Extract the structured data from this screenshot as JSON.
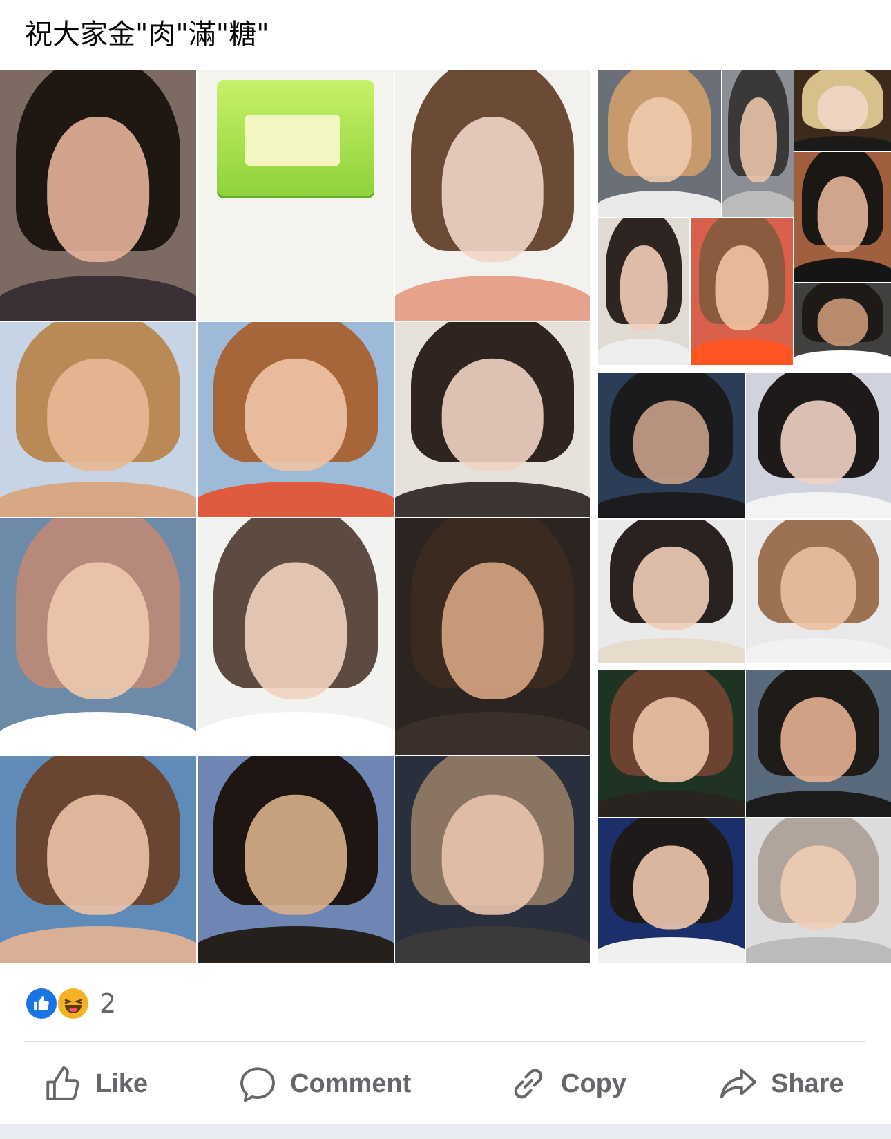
{
  "post": {
    "text": "祝大家金\"肉\"滿\"糖\""
  },
  "media": {
    "tiles": [
      {
        "kind": "portrait",
        "hair": "#1e1712",
        "skin": "#e5b39a",
        "bg": "#7d6b63",
        "top": "#3a3035"
      },
      {
        "kind": "product",
        "bg": "#f4f4ef"
      },
      {
        "kind": "portrait",
        "hair": "#6b4a36",
        "skin": "#f1d5c6",
        "bg": "#f3f1ee",
        "top": "#e6a28a"
      },
      {
        "kind": "portrait",
        "hair": "#b98a55",
        "skin": "#e8b896",
        "bg": "#c6d4e5",
        "top": "#d8a783"
      },
      {
        "kind": "portrait",
        "hair": "#a7653a",
        "skin": "#f0c4a7",
        "bg": "#9dbbd8",
        "top": "#e05a3d"
      },
      {
        "kind": "portrait",
        "hair": "#2f241f",
        "skin": "#f1d3c2",
        "bg": "#e7e1dc",
        "top": "#3c3533"
      },
      {
        "kind": "portrait",
        "hair": "#b7897a",
        "skin": "#f0c8ae",
        "bg": "#6d8aa8",
        "top": "#ffffff"
      },
      {
        "kind": "portrait",
        "hair": "#5d4a40",
        "skin": "#f1d2c0",
        "bg": "#f2f2f0",
        "top": "#ffffff"
      },
      {
        "kind": "portrait",
        "hair": "#3a2a20",
        "skin": "#d7a583",
        "bg": "#2b2420",
        "top": "#3a2f2a"
      },
      {
        "kind": "portrait",
        "hair": "#6a4531",
        "skin": "#ecc2a7",
        "bg": "#5f8bb8",
        "top": "#d9b095"
      },
      {
        "kind": "portrait",
        "hair": "#1f1512",
        "skin": "#d8b08a",
        "bg": "#6f86b5",
        "top": "#26201d"
      },
      {
        "kind": "portrait",
        "hair": "#8a7563",
        "skin": "#e9c4ad",
        "bg": "#2a2f3e",
        "top": "#3a3a3a"
      },
      {
        "kind": "portrait",
        "hair": "#c79a6e",
        "skin": "#f0c9ac",
        "bg": "#6b6f77",
        "top": "#e9e9ea"
      },
      {
        "kind": "portrait",
        "hair": "#3a3838",
        "skin": "#eac3a8",
        "bg": "#8b8e94",
        "top": "#bdbcbd"
      },
      {
        "kind": "portrait",
        "hair": "#d7c08b",
        "skin": "#f0d7c6",
        "bg": "#3d2a1c",
        "top": "#1b1a18"
      },
      {
        "kind": "portrait",
        "hair": "#1a1715",
        "skin": "#e6b49a",
        "bg": "#a0603f",
        "top": "#151515"
      },
      {
        "kind": "portrait",
        "hair": "#2e2523",
        "skin": "#f3ccb8",
        "bg": "#e0dbd2",
        "top": "#eeeeee"
      },
      {
        "kind": "portrait",
        "hair": "#8b5b3f",
        "skin": "#efc4a2",
        "bg": "#d9604a",
        "top": "#ff5522"
      },
      {
        "kind": "portrait",
        "hair": "#1d1a18",
        "skin": "#c99876",
        "bg": "#40403f",
        "top": "#ffffff"
      },
      {
        "kind": "portrait",
        "hair": "#1b1b1e",
        "skin": "#c9a088",
        "bg": "#2c3d57",
        "top": "#1b1c1f"
      },
      {
        "kind": "portrait",
        "hair": "#1f1a1a",
        "skin": "#f0d2c3",
        "bg": "#d0d2de",
        "top": "#f3f3f3"
      },
      {
        "kind": "portrait",
        "hair": "#2a2220",
        "skin": "#f0cdb7",
        "bg": "#eaeaea",
        "top": "#e7dccb"
      },
      {
        "kind": "portrait",
        "hair": "#9d7252",
        "skin": "#ecc1a2",
        "bg": "#e9e9ec",
        "top": "#f2f2f2"
      },
      {
        "kind": "portrait",
        "hair": "#6b4330",
        "skin": "#efc3a7",
        "bg": "#1f3322",
        "top": "#2a2421"
      },
      {
        "kind": "portrait",
        "hair": "#1f1b19",
        "skin": "#e4b091",
        "bg": "#596a7c",
        "top": "#1d1c1c"
      },
      {
        "kind": "portrait",
        "hair": "#1e1a19",
        "skin": "#efc8ae",
        "bg": "#1d2f6a",
        "top": "#f0f0f0"
      },
      {
        "kind": "portrait",
        "hair": "#b0a49c",
        "skin": "#f0cdb5",
        "bg": "#dcdcdc",
        "top": "#bbbbbb"
      }
    ]
  },
  "reactions": {
    "count": "2",
    "like_color": "#1b74e4",
    "haha_color": "#f7b125",
    "icons": [
      "like-reaction-icon",
      "haha-reaction-icon"
    ]
  },
  "actions": {
    "like_label": "Like",
    "comment_label": "Comment",
    "copy_label": "Copy",
    "share_label": "Share"
  }
}
